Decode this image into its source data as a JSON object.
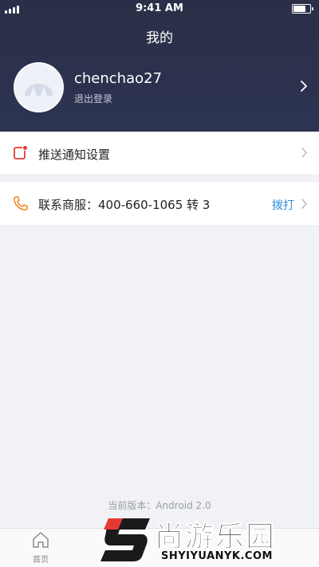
{
  "status_bar": {
    "time": "9:41 AM",
    "battery_level": 0.7,
    "signal_bars": 4
  },
  "header": {
    "title": "我的"
  },
  "profile": {
    "username": "chenchao27",
    "logout_label": "退出登录"
  },
  "menu": {
    "push": {
      "label": "推送通知设置",
      "icon": "notification-square-icon"
    },
    "phone": {
      "label": "联系商服：400-660-1065 转 3",
      "action_label": "拨打",
      "icon": "phone-icon"
    }
  },
  "version": "当前版本：Android 2.0",
  "tabbar": {
    "home_label": "首页"
  },
  "watermark": {
    "text_cn": "尚游乐园",
    "text_en": "SHYIYUANYK.COM"
  },
  "colors": {
    "header_bg": "#2c3250",
    "accent_blue": "#2d8ed3",
    "icon_red": "#e53935",
    "icon_orange": "#f08a24"
  }
}
